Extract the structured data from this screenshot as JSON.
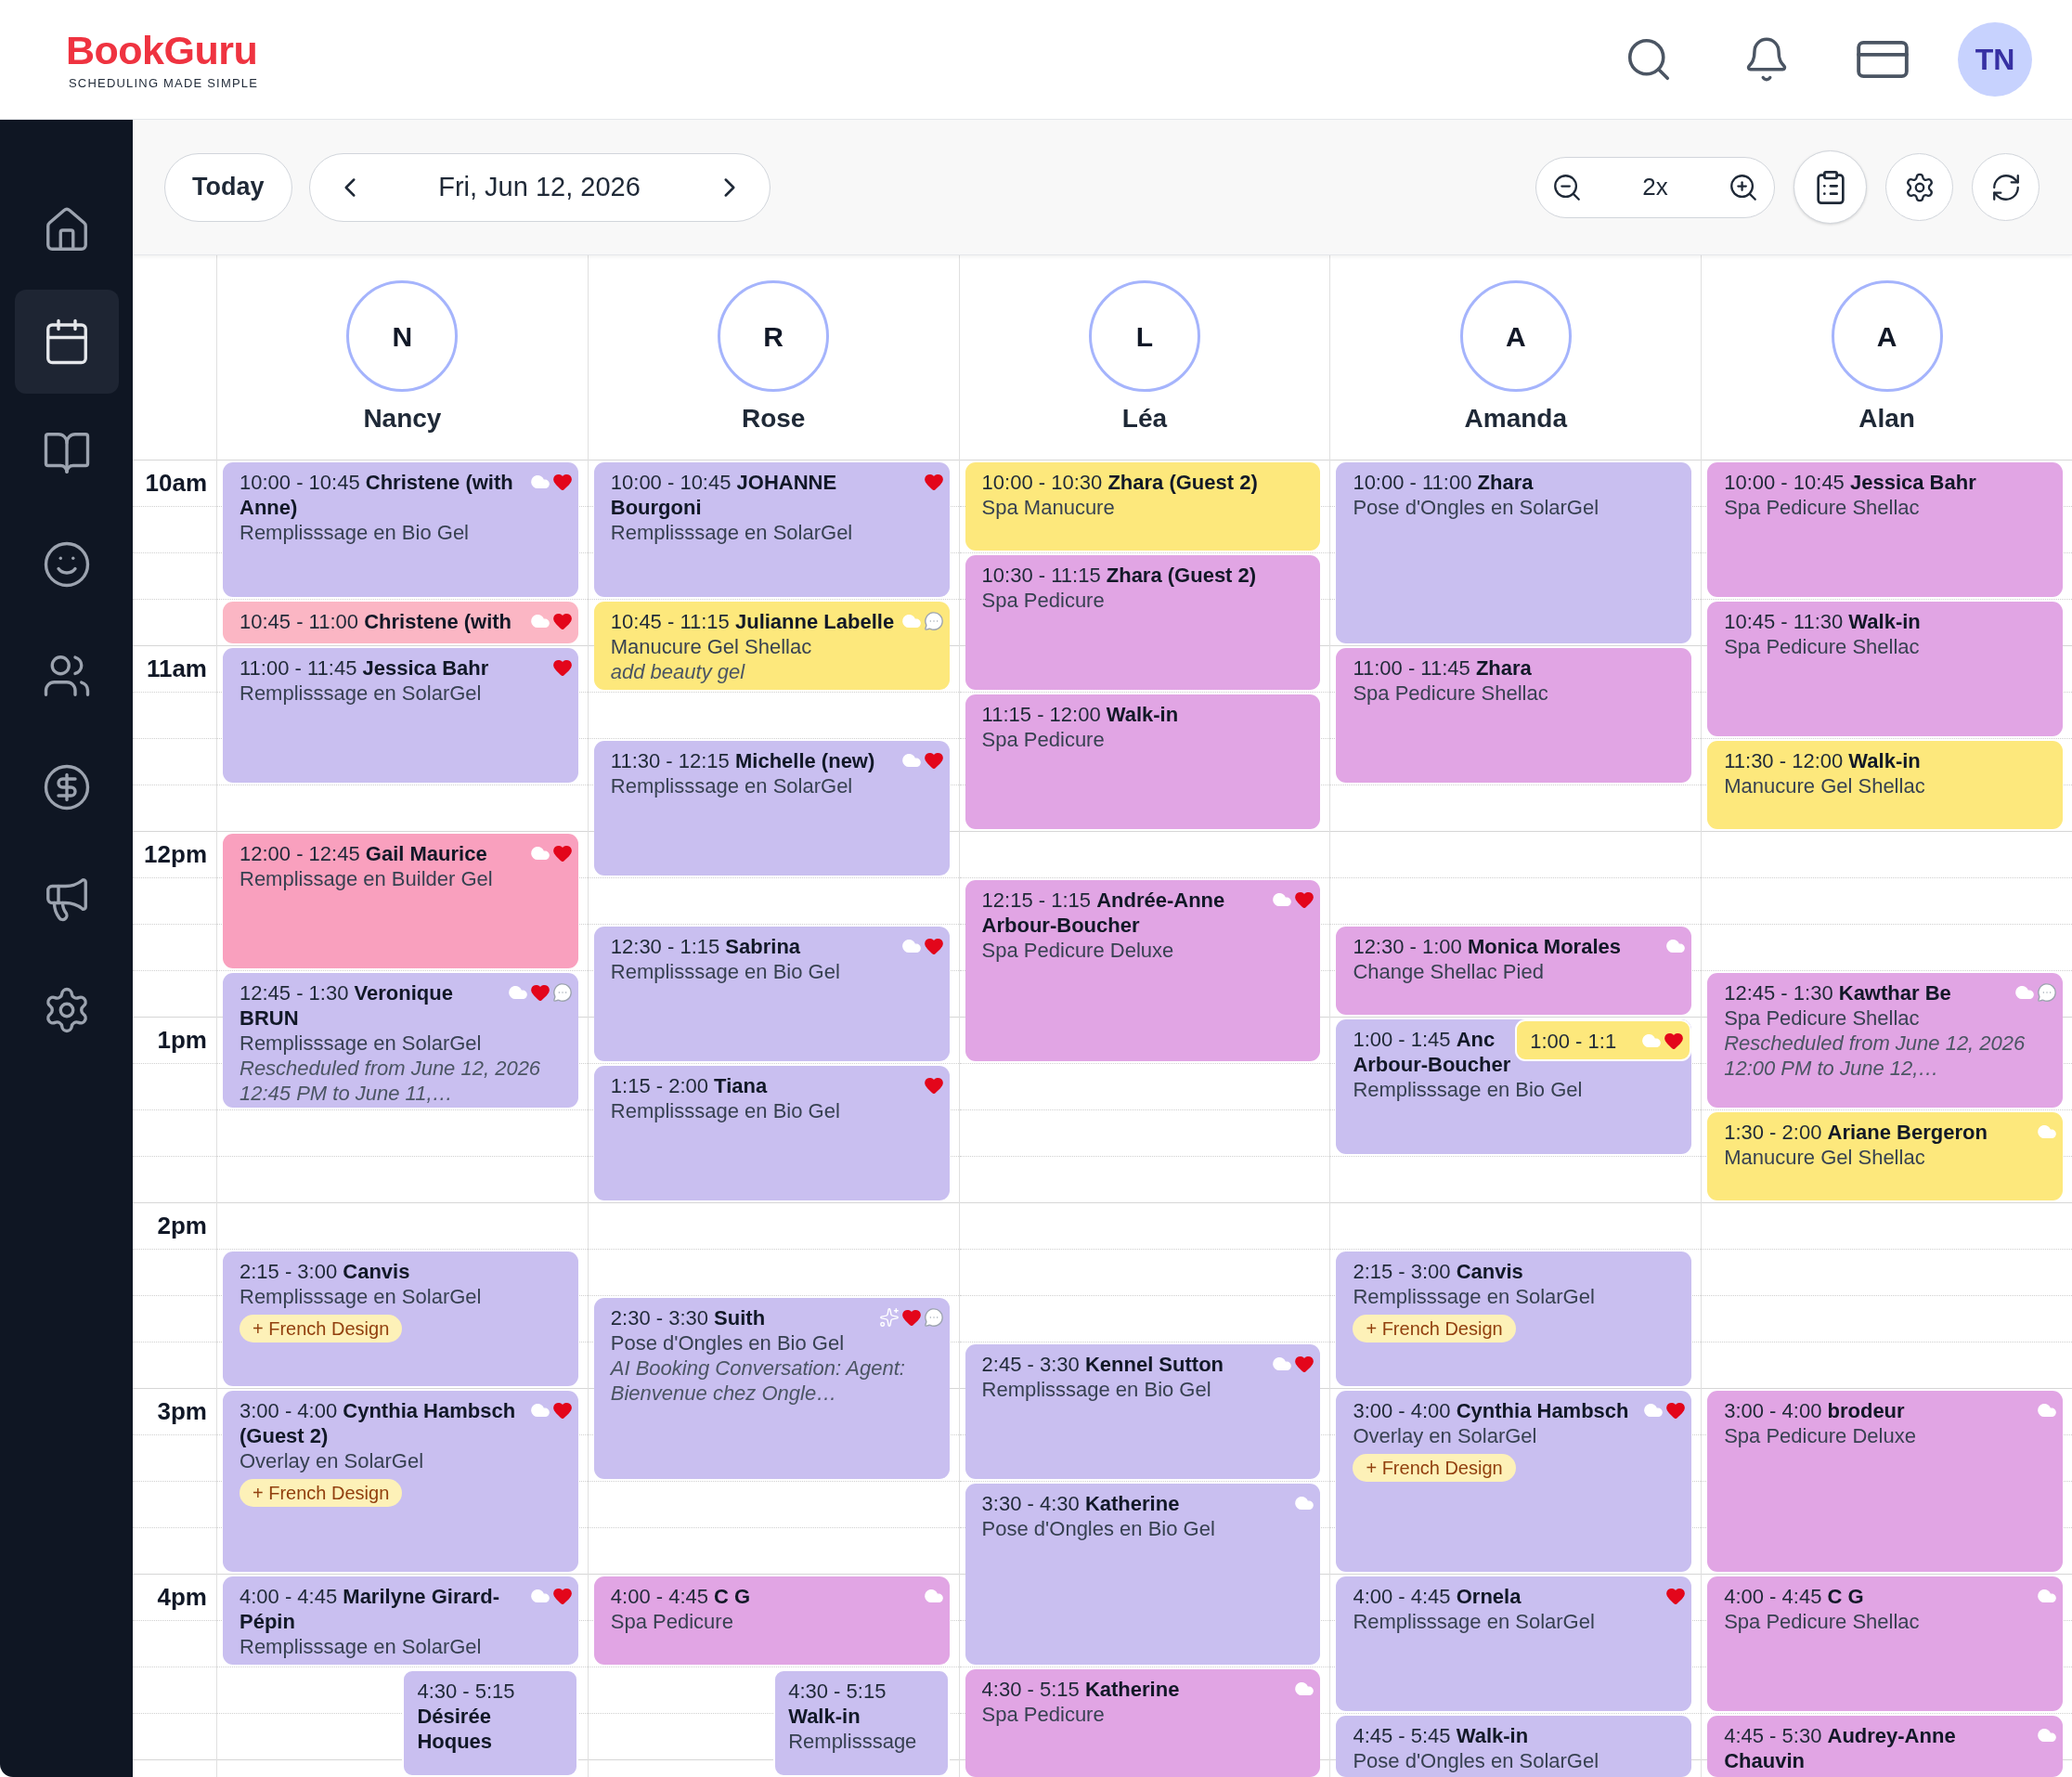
{
  "brand": {
    "name": "BookGuru",
    "tagline": "SCHEDULING MADE SIMPLE"
  },
  "user": {
    "initials": "TN"
  },
  "sidebar": {
    "items": [
      {
        "kind": "home",
        "selected": false
      },
      {
        "kind": "calendar",
        "selected": true
      },
      {
        "kind": "book",
        "selected": false
      },
      {
        "kind": "smile",
        "selected": false
      },
      {
        "kind": "users",
        "selected": false
      },
      {
        "kind": "dollar",
        "selected": false
      },
      {
        "kind": "megaphone",
        "selected": false
      },
      {
        "kind": "settings",
        "selected": false
      }
    ]
  },
  "toolbar": {
    "today": "Today",
    "date": "Fri, Jun 12, 2026",
    "zoom": "2x"
  },
  "hours": [
    "10am",
    "11am",
    "12pm",
    "1pm",
    "2pm",
    "3pm",
    "4pm"
  ],
  "staff": [
    {
      "initial": "N",
      "name": "Nancy",
      "appointments": [
        {
          "time": "10:00 - 10:45",
          "client": "Christene (with Anne)",
          "service": "Remplisssage en Bio Gel",
          "color": "#c9bff0",
          "overlap": false,
          "icons": [
            {
              "kind": "cloud"
            },
            {
              "kind": "heart"
            }
          ]
        },
        {
          "time": "10:45 - 11:00",
          "client": "Christene (with",
          "color": "#fbb6c4",
          "overlap": false,
          "icons": [
            {
              "kind": "cloud"
            },
            {
              "kind": "heart"
            }
          ]
        },
        {
          "time": "11:00 - 11:45",
          "client": "Jessica Bahr",
          "service": "Remplisssage en SolarGel",
          "color": "#c9bff0",
          "overlap": false,
          "icons": [
            {
              "kind": "heart"
            }
          ]
        },
        {
          "time": "12:00 - 12:45",
          "client": "Gail Maurice",
          "service": "Remplissage en Builder Gel",
          "color": "#f9a0be",
          "overlap": false,
          "icons": [
            {
              "kind": "cloud"
            },
            {
              "kind": "heart"
            }
          ]
        },
        {
          "time": "12:45 - 1:30",
          "client": "Veronique BRUN",
          "service": "Remplisssage en SolarGel",
          "note": "Rescheduled from June 12, 2026 12:45 PM to June 11,…",
          "color": "#c9bff0",
          "overlap": false,
          "icons": [
            {
              "kind": "cloud"
            },
            {
              "kind": "heart"
            },
            {
              "kind": "chat"
            }
          ]
        },
        {
          "time": "2:15 - 3:00",
          "client": "Canvis",
          "service": "Remplisssage en SolarGel",
          "addon": "+ French Design",
          "color": "#c9bff0",
          "overlap": false
        },
        {
          "time": "3:00 - 4:00",
          "client": "Cynthia Hambsch (Guest 2)",
          "service": "Overlay en SolarGel",
          "addon": "+ French Design",
          "color": "#c9bff0",
          "overlap": false,
          "icons": [
            {
              "kind": "cloud"
            },
            {
              "kind": "heart"
            }
          ]
        },
        {
          "time": "4:00 - 4:45",
          "client": "Marilyne Girard-Pépin",
          "service": "Remplisssage en SolarGel",
          "color": "#c9bff0",
          "overlap": false,
          "icons": [
            {
              "kind": "cloud"
            },
            {
              "kind": "heart"
            }
          ]
        },
        {
          "time": "4:30 - 5:15",
          "client": "Désirée Hoques",
          "color": "#c9bff0",
          "overlap": true
        }
      ]
    },
    {
      "initial": "R",
      "name": "Rose",
      "appointments": [
        {
          "time": "10:00 - 10:45",
          "client": "JOHANNE Bourgoni",
          "service": "Remplisssage en SolarGel",
          "color": "#c9bff0",
          "overlap": false,
          "icons": [
            {
              "kind": "heart"
            }
          ]
        },
        {
          "time": "10:45 - 11:15",
          "client": "Julianne Labelle",
          "service": "Manucure Gel Shellac",
          "note": "add beauty gel",
          "color": "#fde87c",
          "overlap": false,
          "icons": [
            {
              "kind": "cloud"
            },
            {
              "kind": "chat"
            }
          ]
        },
        {
          "time": "11:30 - 12:15",
          "client": "Michelle (new)",
          "service": "Remplisssage en SolarGel",
          "color": "#c9bff0",
          "overlap": false,
          "icons": [
            {
              "kind": "cloud"
            },
            {
              "kind": "heart"
            }
          ]
        },
        {
          "time": "12:30 - 1:15",
          "client": "Sabrina",
          "service": "Remplisssage en Bio Gel",
          "color": "#c9bff0",
          "overlap": false,
          "icons": [
            {
              "kind": "cloud"
            },
            {
              "kind": "heart"
            }
          ]
        },
        {
          "time": "1:15 - 2:00",
          "client": "Tiana",
          "service": "Remplisssage en Bio Gel",
          "color": "#c9bff0",
          "overlap": false,
          "icons": [
            {
              "kind": "heart"
            }
          ]
        },
        {
          "time": "2:30 - 3:30",
          "client": "Suith",
          "service": "Pose d'Ongles en Bio Gel",
          "note": "AI Booking Conversation: Agent: Bienvenue chez Ongle…",
          "color": "#c9bff0",
          "overlap": false,
          "icons": [
            {
              "kind": "sparkles"
            },
            {
              "kind": "heart"
            },
            {
              "kind": "chat"
            }
          ]
        },
        {
          "time": "4:00 - 4:45",
          "client": "C G",
          "service": "Spa Pedicure",
          "color": "#e1a5e4",
          "overlap": false,
          "icons": [
            {
              "kind": "cloud"
            }
          ]
        },
        {
          "time": "4:30 - 5:15",
          "client": "Walk-in",
          "service": "Remplisssage",
          "color": "#c9bff0",
          "overlap": true
        }
      ]
    },
    {
      "initial": "L",
      "name": "Léa",
      "appointments": [
        {
          "time": "10:00 - 10:30",
          "client": "Zhara (Guest 2)",
          "service": "Spa Manucure",
          "color": "#fde87c",
          "overlap": false
        },
        {
          "time": "10:30 - 11:15",
          "client": "Zhara (Guest 2)",
          "service": "Spa Pedicure",
          "color": "#e1a5e4",
          "overlap": false
        },
        {
          "time": "11:15 - 12:00",
          "client": "Walk-in",
          "service": "Spa Pedicure",
          "color": "#e1a5e4",
          "overlap": false
        },
        {
          "time": "12:15 - 1:15",
          "client": "Andrée-Anne Arbour-Boucher",
          "service": "Spa Pedicure Deluxe",
          "color": "#e1a5e4",
          "overlap": false,
          "icons": [
            {
              "kind": "cloud"
            },
            {
              "kind": "heart"
            }
          ]
        },
        {
          "time": "2:45 - 3:30",
          "client": "Kennel Sutton",
          "service": "Remplisssage en Bio Gel",
          "color": "#c9bff0",
          "overlap": false,
          "icons": [
            {
              "kind": "cloud"
            },
            {
              "kind": "heart"
            }
          ]
        },
        {
          "time": "3:30 - 4:30",
          "client": "Katherine",
          "service": "Pose d'Ongles en Bio Gel",
          "color": "#c9bff0",
          "overlap": false,
          "icons": [
            {
              "kind": "cloud"
            }
          ]
        },
        {
          "time": "4:30 - 5:15",
          "client": "Katherine",
          "service": "Spa Pedicure",
          "color": "#e1a5e4",
          "overlap": false,
          "icons": [
            {
              "kind": "cloud"
            }
          ]
        }
      ]
    },
    {
      "initial": "A",
      "name": "Amanda",
      "appointments": [
        {
          "time": "10:00 - 11:00",
          "client": "Zhara",
          "service": "Pose d'Ongles en SolarGel",
          "color": "#c9bff0",
          "overlap": false
        },
        {
          "time": "11:00 - 11:45",
          "client": "Zhara",
          "service": "Spa Pedicure Shellac",
          "color": "#e1a5e4",
          "overlap": false
        },
        {
          "time": "12:30 - 1:00",
          "client": "Monica Morales",
          "service": "Change Shellac Pied",
          "color": "#e1a5e4",
          "overlap": false,
          "icons": [
            {
              "kind": "cloud"
            }
          ]
        },
        {
          "time": "1:00 - 1:45",
          "client": "Anc Arbour-Boucher",
          "service": "Remplisssage en Bio Gel",
          "color": "#c9bff0",
          "overlap": false
        },
        {
          "time": "1:00 - 1:1",
          "color": "#fde87c",
          "overlap": true,
          "icons": [
            {
              "kind": "cloud"
            },
            {
              "kind": "heart"
            }
          ]
        },
        {
          "time": "2:15 - 3:00",
          "client": "Canvis",
          "service": "Remplisssage en SolarGel",
          "addon": "+ French Design",
          "color": "#c9bff0",
          "overlap": false
        },
        {
          "time": "3:00 - 4:00",
          "client": "Cynthia Hambsch",
          "service": "Overlay en SolarGel",
          "addon": "+ French Design",
          "color": "#c9bff0",
          "overlap": false,
          "icons": [
            {
              "kind": "cloud"
            },
            {
              "kind": "heart"
            }
          ]
        },
        {
          "time": "4:00 - 4:45",
          "client": "Ornela",
          "service": "Remplisssage en SolarGel",
          "color": "#c9bff0",
          "overlap": false,
          "icons": [
            {
              "kind": "heart"
            }
          ]
        },
        {
          "time": "4:45 - 5:45",
          "client": "Walk-in",
          "service": "Pose d'Ongles en SolarGel",
          "color": "#c9bff0",
          "overlap": false
        }
      ]
    },
    {
      "initial": "A",
      "name": "Alan",
      "appointments": [
        {
          "time": "10:00 - 10:45",
          "client": "Jessica Bahr",
          "service": "Spa Pedicure Shellac",
          "color": "#e1a5e4",
          "overlap": false
        },
        {
          "time": "10:45 - 11:30",
          "client": "Walk-in",
          "service": "Spa Pedicure Shellac",
          "color": "#e1a5e4",
          "overlap": false
        },
        {
          "time": "11:30 - 12:00",
          "client": "Walk-in",
          "service": "Manucure Gel Shellac",
          "color": "#fde87c",
          "overlap": false
        },
        {
          "time": "12:45 - 1:30",
          "client": "Kawthar Be",
          "service": "Spa Pedicure Shellac",
          "note": "Rescheduled from June 12, 2026 12:00 PM to June 12,…",
          "color": "#e1a5e4",
          "overlap": false,
          "icons": [
            {
              "kind": "cloud"
            },
            {
              "kind": "chat"
            }
          ]
        },
        {
          "time": "1:30 - 2:00",
          "client": "Ariane Bergeron",
          "service": "Manucure Gel Shellac",
          "color": "#fde87c",
          "overlap": false,
          "icons": [
            {
              "kind": "cloud"
            }
          ]
        },
        {
          "time": "3:00 - 4:00",
          "client": "brodeur",
          "service": "Spa Pedicure Deluxe",
          "color": "#e1a5e4",
          "overlap": false,
          "icons": [
            {
              "kind": "cloud"
            }
          ]
        },
        {
          "time": "4:00 - 4:45",
          "client": "C G",
          "service": "Spa Pedicure Shellac",
          "color": "#e1a5e4",
          "overlap": false,
          "icons": [
            {
              "kind": "cloud"
            }
          ]
        },
        {
          "time": "4:45 - 5:30",
          "client": "Audrey-Anne Chauvin",
          "color": "#e1a5e4",
          "overlap": false,
          "icons": [
            {
              "kind": "cloud"
            }
          ]
        }
      ]
    }
  ]
}
